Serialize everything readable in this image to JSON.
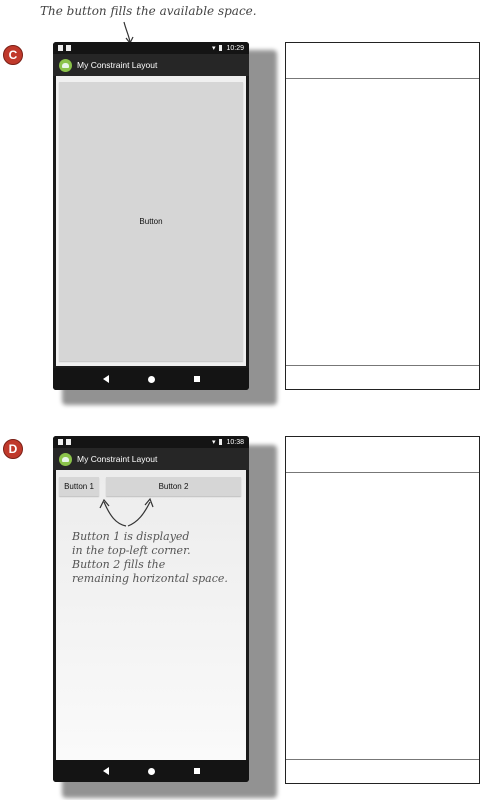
{
  "top_caption": "The button fills the available space.",
  "panels": [
    {
      "badge": "C",
      "status_time": "10:29",
      "app_title": "My Constraint Layout",
      "buttons": [
        "Button"
      ]
    },
    {
      "badge": "D",
      "status_time": "10:38",
      "app_title": "My Constraint Layout",
      "buttons": [
        "Button 1",
        "Button 2"
      ],
      "annotation": [
        "Button 1 is displayed",
        "in the top-left corner.",
        "Button 2 fills the",
        "remaining horizontal space."
      ]
    }
  ],
  "colors": {
    "badge": "#c0392b",
    "button": "#d6d6d6",
    "app_icon": "#8bc34a"
  }
}
